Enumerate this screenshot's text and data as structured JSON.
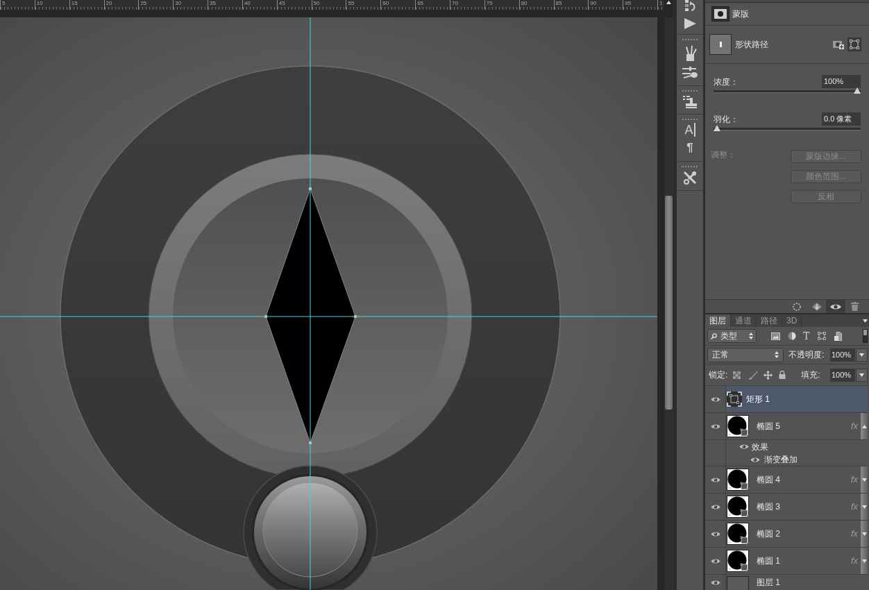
{
  "ruler": {
    "labels": [
      "5",
      "10",
      "15",
      "20",
      "25",
      "30",
      "35",
      "40",
      "45",
      "50",
      "55",
      "60",
      "65",
      "70",
      "75",
      "80",
      "85",
      "90",
      "95",
      "1"
    ]
  },
  "toolbar": {
    "character_glyph": "A",
    "paragraph_glyph": "¶"
  },
  "properties": {
    "title": "蒙版",
    "shape": {
      "label": "形状路径"
    },
    "density": {
      "label": "浓度：",
      "value": "100%",
      "level": 1
    },
    "feather": {
      "label": "羽化：",
      "value": "0.0 像素",
      "level": 0
    },
    "adjust": {
      "label": "调整：",
      "disabled": true,
      "buttons": [
        {
          "label": "蒙版边缘...",
          "disabled": true
        },
        {
          "label": "颜色范围...",
          "disabled": true
        },
        {
          "label": "反相",
          "disabled": true
        }
      ]
    }
  },
  "layers_panel": {
    "tabs": [
      {
        "label": "图层",
        "selected": true
      },
      {
        "label": "通道",
        "selected": false
      },
      {
        "label": "路径",
        "selected": false
      },
      {
        "label": "3D",
        "selected": false
      }
    ],
    "filter": {
      "value": "类型",
      "type_glyph": "T"
    },
    "blend_mode": {
      "value": "正常"
    },
    "opacity": {
      "label": "不透明度:",
      "value": "100%"
    },
    "lock": {
      "label": "锁定:"
    },
    "fill": {
      "label": "填充:",
      "value": "100%"
    },
    "layers": [
      {
        "name": "矩形 1",
        "kind": "rectangle",
        "visible": true,
        "selected": true
      },
      {
        "name": "椭圆 5",
        "kind": "ellipse",
        "visible": true,
        "selected": false,
        "fx": "fx",
        "expanded": true,
        "effects": {
          "label": "效果",
          "visible": true,
          "children": [
            {
              "label": "渐变叠加",
              "visible": true
            }
          ]
        }
      },
      {
        "name": "椭圆 4",
        "kind": "ellipse",
        "visible": true,
        "selected": false,
        "fx": "fx",
        "expanded": false
      },
      {
        "name": "椭圆 3",
        "kind": "ellipse",
        "visible": true,
        "selected": false,
        "fx": "fx",
        "expanded": false
      },
      {
        "name": "椭圆 2",
        "kind": "ellipse",
        "visible": true,
        "selected": false,
        "fx": "fx",
        "expanded": false
      },
      {
        "name": "椭圆 1",
        "kind": "ellipse",
        "visible": true,
        "selected": false,
        "fx": "fx",
        "expanded": false
      },
      {
        "name": "图层 1",
        "kind": "pixel",
        "visible": true,
        "selected": false
      }
    ]
  }
}
